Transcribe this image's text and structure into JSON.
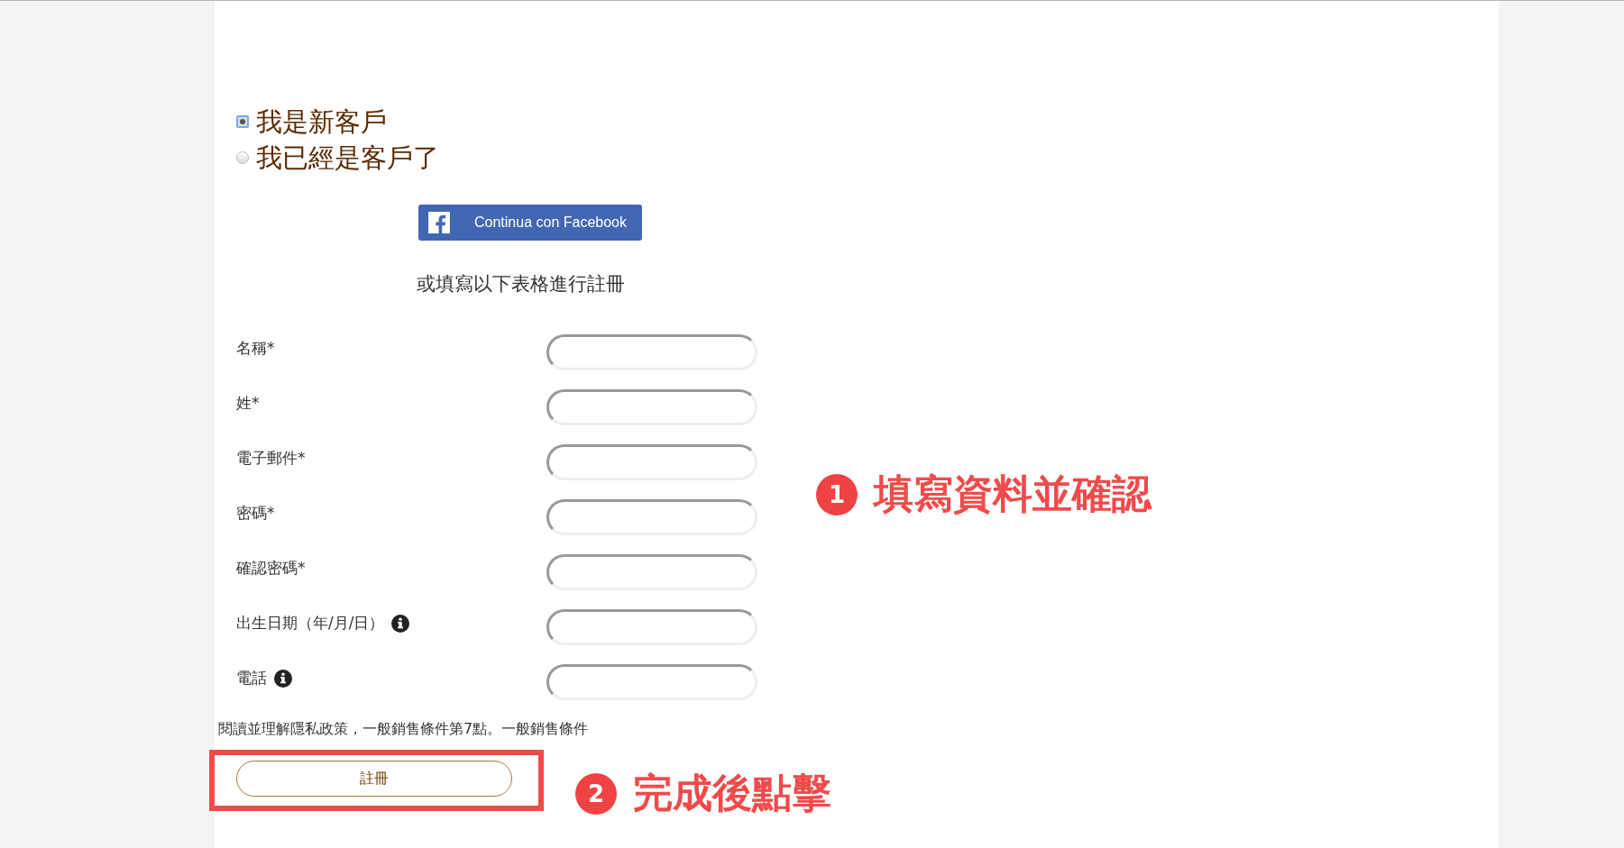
{
  "customer_type": [
    {
      "label": "我是新客戶",
      "selected": true
    },
    {
      "label": "我已經是客戶了",
      "selected": false
    }
  ],
  "facebook_button": {
    "label": "Continua con Facebook"
  },
  "or_text": "或填寫以下表格進行註冊",
  "fields": [
    {
      "label": "名稱*",
      "info": false
    },
    {
      "label": "姓*",
      "info": false
    },
    {
      "label": "電子郵件*",
      "info": false
    },
    {
      "label": "密碼*",
      "info": false
    },
    {
      "label": "確認密碼*",
      "info": false
    },
    {
      "label": "出生日期（年/月/日）",
      "info": true
    },
    {
      "label": "電話",
      "info": true
    }
  ],
  "privacy_text": "閱讀並理解隱私政策，一般銷售條件第7點。一般銷售條件",
  "register_button": {
    "label": "註冊"
  },
  "annotations": [
    {
      "number": "1",
      "text": "填寫資料並確認"
    },
    {
      "number": "2",
      "text": "完成後點擊"
    }
  ]
}
